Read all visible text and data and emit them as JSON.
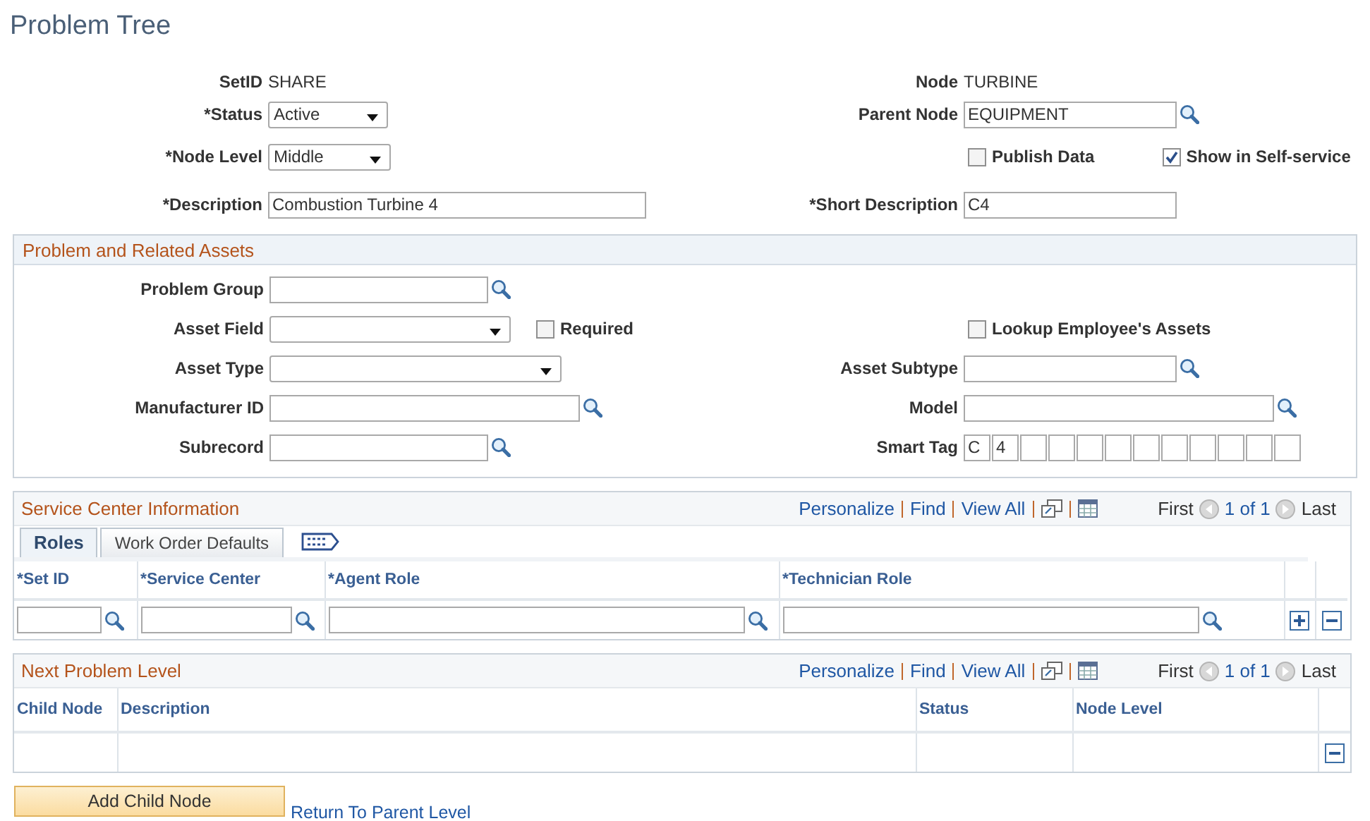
{
  "page_title": "Problem Tree",
  "header": {
    "rows": [
      {
        "left": [
          {
            "kind": "display",
            "label": "SetID",
            "value": "SHARE"
          }
        ],
        "right": [
          {
            "kind": "display",
            "label": "Node",
            "value": "TURBINE"
          }
        ]
      },
      {
        "left": [
          {
            "kind": "select",
            "label": "*Status",
            "value": "Active"
          }
        ],
        "right": [
          {
            "kind": "lookup",
            "label": "Parent Node",
            "value": "EQUIPMENT"
          }
        ]
      },
      {
        "left": [
          {
            "kind": "select",
            "label": "*Node Level",
            "value": "Middle"
          }
        ],
        "right": [
          {
            "kind": "checkbox",
            "label": "Publish Data",
            "checked": false
          },
          {
            "kind": "checkbox",
            "label": "Show in Self-service",
            "checked": true
          }
        ]
      },
      {
        "left": [
          {
            "kind": "text",
            "label": "*Description",
            "value": "Combustion Turbine 4"
          }
        ],
        "right": [
          {
            "kind": "text",
            "label": "*Short Description",
            "value": "C4"
          }
        ]
      }
    ]
  },
  "assets": {
    "title": "Problem and Related Assets",
    "rows": [
      {
        "left": [
          {
            "kind": "lookup",
            "label": "Problem Group"
          }
        ]
      },
      {
        "left": [
          {
            "kind": "select",
            "label": "Asset Field"
          },
          {
            "kind": "checkbox",
            "label": "Required",
            "checked": false
          }
        ],
        "right": [
          {
            "kind": "checkbox",
            "label": "Lookup Employee's Assets",
            "checked": false
          }
        ]
      },
      {
        "left": [
          {
            "kind": "select",
            "label": "Asset Type"
          }
        ],
        "right": [
          {
            "kind": "lookup",
            "label": "Asset Subtype"
          }
        ]
      },
      {
        "left": [
          {
            "kind": "lookup",
            "label": "Manufacturer ID"
          }
        ],
        "right": [
          {
            "kind": "lookup",
            "label": "Model"
          }
        ]
      },
      {
        "left": [
          {
            "kind": "lookup",
            "label": "Subrecord"
          }
        ],
        "right": [
          {
            "kind": "smarttag",
            "label": "Smart Tag",
            "values": [
              "C",
              "4"
            ]
          }
        ]
      }
    ]
  },
  "grids": [
    {
      "title": "Service Center Information",
      "links": [
        "Personalize",
        "Find",
        "View All"
      ],
      "nav": {
        "first": "First",
        "count": "1 of 1",
        "last": "Last"
      },
      "tabs": [
        {
          "label": "Roles",
          "selected": true
        },
        {
          "label": "Work Order Defaults",
          "selected": false
        }
      ],
      "columns": [
        "*Set ID",
        "*Service Center",
        "*Agent Role",
        "*Technician Role"
      ],
      "rows": [
        {
          "editable": true
        }
      ],
      "add_row": true,
      "delete_row": true
    },
    {
      "title": "Next Problem Level",
      "links": [
        "Personalize",
        "Find",
        "View All"
      ],
      "nav": {
        "first": "First",
        "count": "1 of 1",
        "last": "Last"
      },
      "columns": [
        "Child Node",
        "Description",
        "Status",
        "Node Level"
      ],
      "rows": [
        {
          "editable": false
        }
      ],
      "add_row": false,
      "delete_row": true
    }
  ],
  "actions": [
    {
      "kind": "button",
      "label": "Add Child Node"
    },
    {
      "kind": "link",
      "label": "Return To Parent Level"
    }
  ]
}
